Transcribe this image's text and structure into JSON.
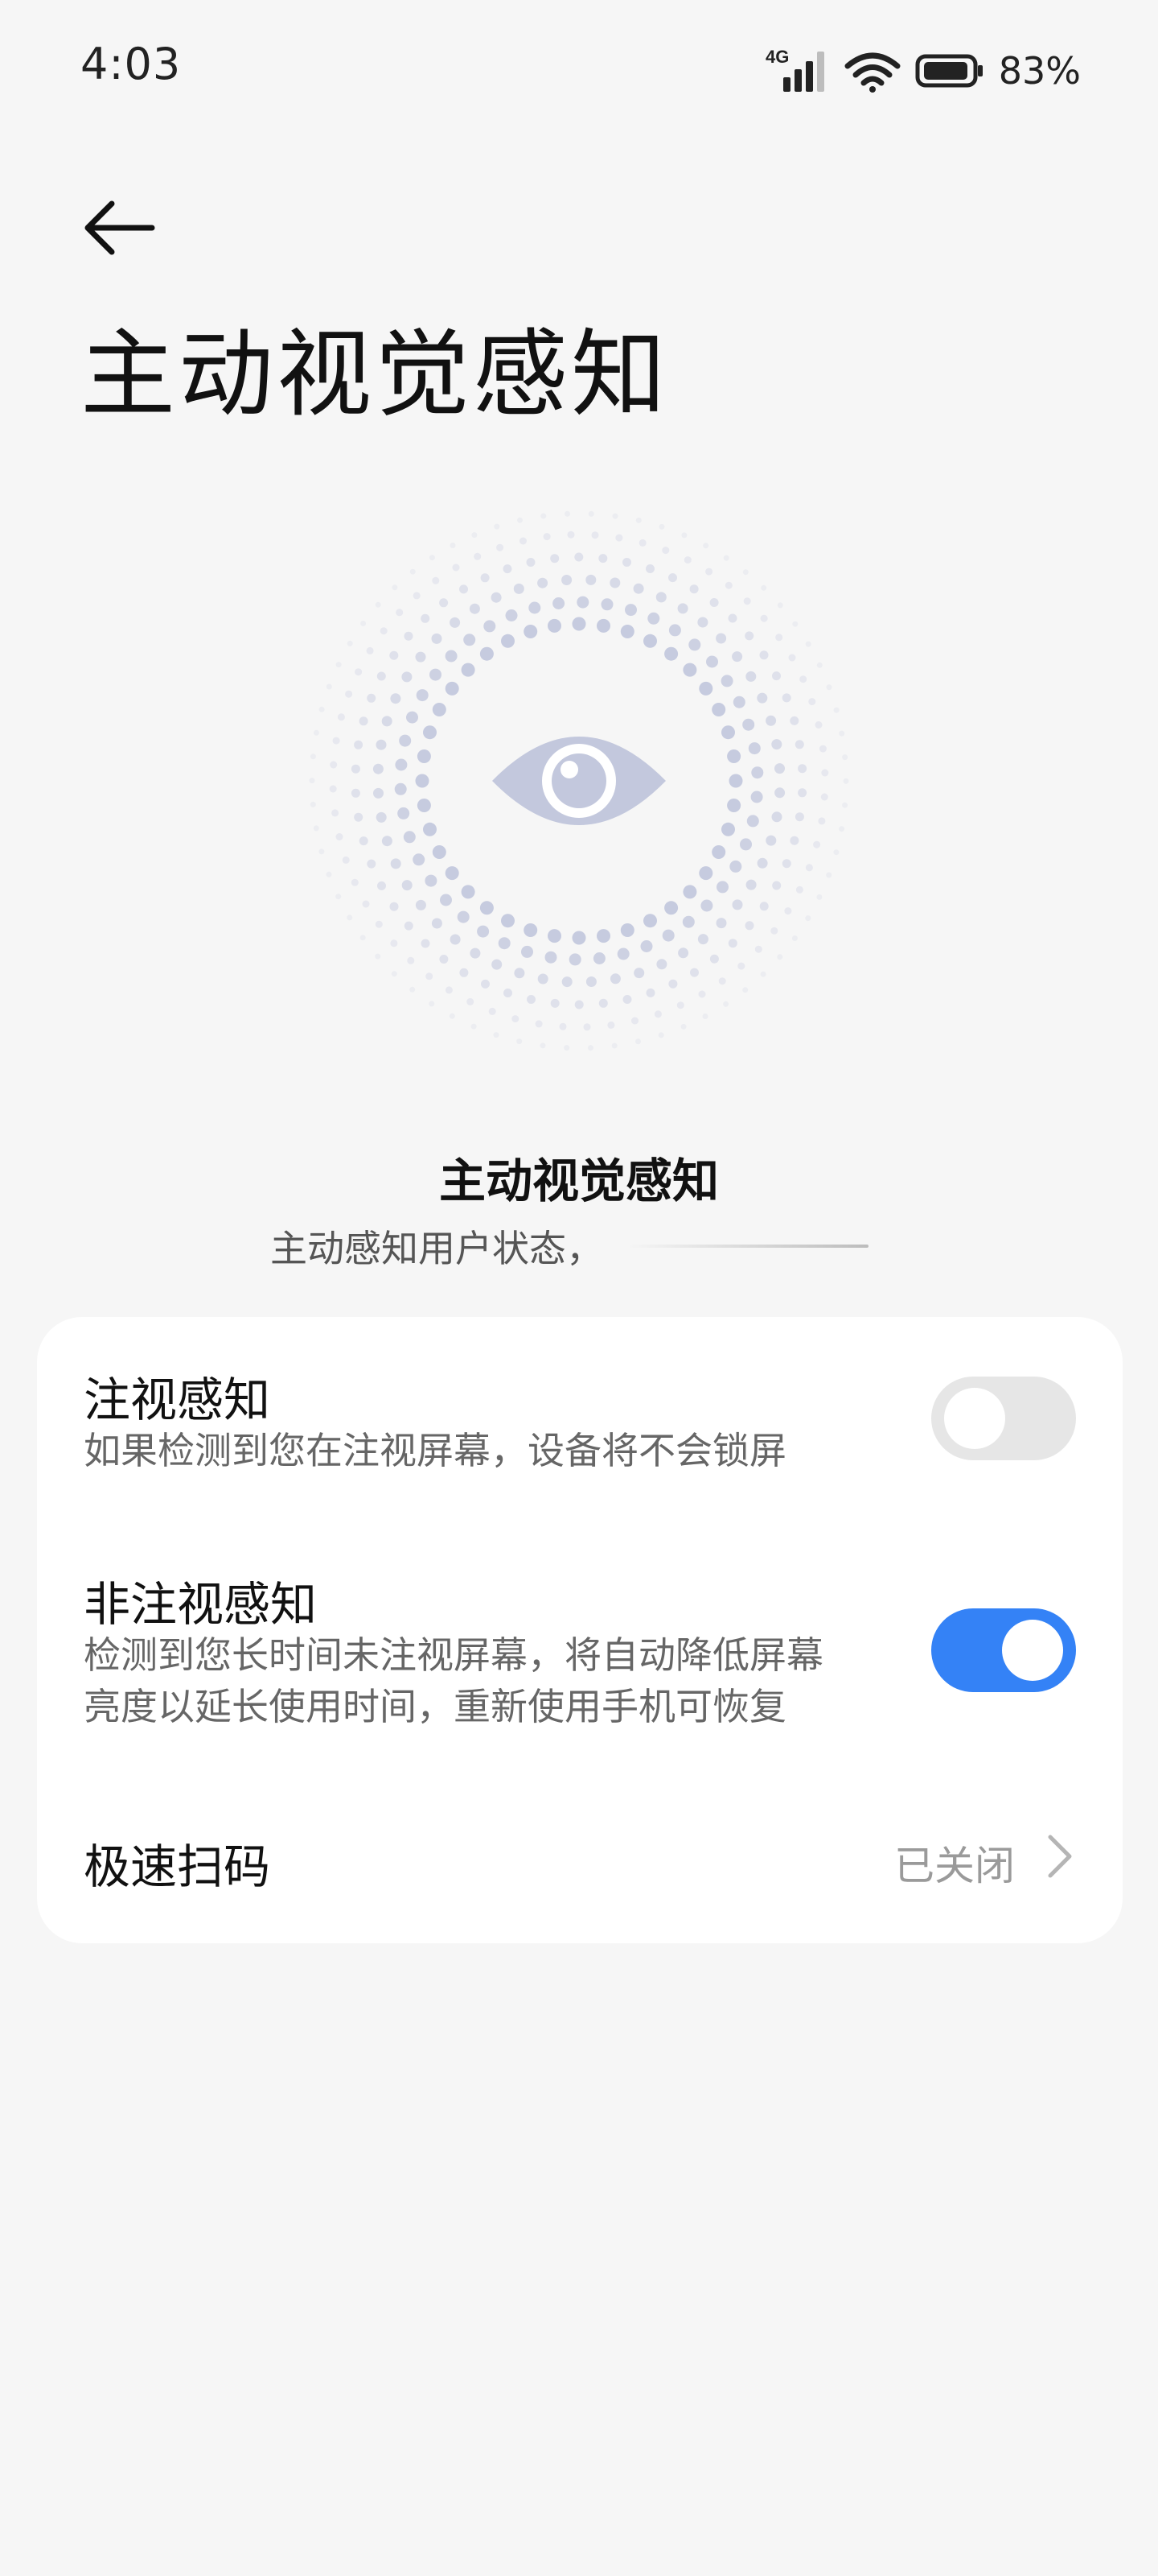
{
  "status_bar": {
    "time": "4:03",
    "network": "4G",
    "battery": "83%"
  },
  "page": {
    "title": "主动视觉感知"
  },
  "hero": {
    "title": "主动视觉感知",
    "subtitle": "主动感知用户状态，"
  },
  "settings": {
    "gaze": {
      "title": "注视感知",
      "desc": "如果检测到您在注视屏幕，设备将不会锁屏",
      "enabled": false
    },
    "non_gaze": {
      "title": "非注视感知",
      "desc_line1": "检测到您长时间未注视屏幕，将自动降低屏幕",
      "desc_line2": "亮度以延长使用时间，重新使用手机可恢复",
      "enabled": true
    },
    "quick_scan": {
      "title": "极速扫码",
      "value": "已关闭"
    }
  },
  "colors": {
    "accent": "#3482f6",
    "eye": "#c3c8dd",
    "background": "#f6f6f6"
  }
}
